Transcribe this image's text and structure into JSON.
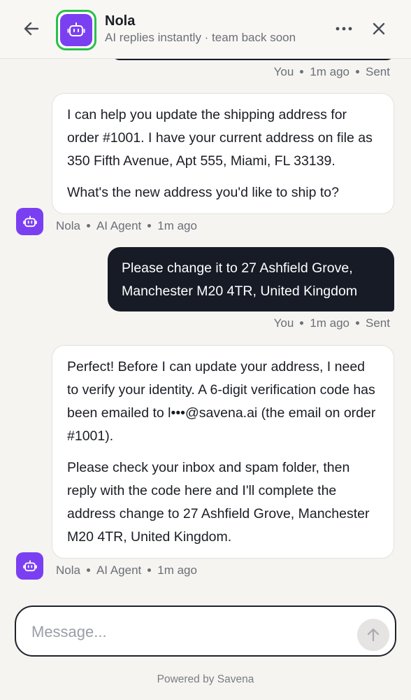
{
  "header": {
    "back_icon": "arrow-left-icon",
    "avatar_icon": "robot-icon",
    "name": "Nola",
    "subtitle": "AI replies instantly · team back soon",
    "more_icon": "more-horizontal-icon",
    "close_icon": "close-icon"
  },
  "messages": [
    {
      "role": "user",
      "meta": {
        "author": "You",
        "time": "1m ago",
        "status": "Sent"
      }
    },
    {
      "role": "agent",
      "paragraphs": [
        "I can help you update the shipping address for order #1001. I have your current address on file as 350 Fifth Avenue, Apt 555, Miami, FL 33139.",
        "What's the new address you'd like to ship to?"
      ],
      "meta": {
        "author": "Nola",
        "role_label": "AI Agent",
        "time": "1m ago"
      }
    },
    {
      "role": "user",
      "text": "Please change it to 27 Ashfield Grove, Manchester M20 4TR, United Kingdom",
      "meta": {
        "author": "You",
        "time": "1m ago",
        "status": "Sent"
      }
    },
    {
      "role": "agent",
      "paragraphs": [
        "Perfect! Before I can update your address, I need to verify your identity. A 6-digit verification code has been emailed to l•••@savena.ai (the email on order #1001).",
        "Please check your inbox and spam folder, then reply with the code here and I'll complete the address change to 27 Ashfield Grove, Manchester M20 4TR, United Kingdom."
      ],
      "meta": {
        "author": "Nola",
        "role_label": "AI Agent",
        "time": "1m ago"
      }
    }
  ],
  "composer": {
    "placeholder": "Message...",
    "value": "",
    "send_icon": "arrow-up-icon"
  },
  "footer": {
    "powered_by": "Powered by Savena"
  },
  "colors": {
    "accent": "#7b3ff2",
    "online_ring": "#28c04a",
    "user_bubble": "#161b26",
    "background": "#f5f4f0"
  }
}
